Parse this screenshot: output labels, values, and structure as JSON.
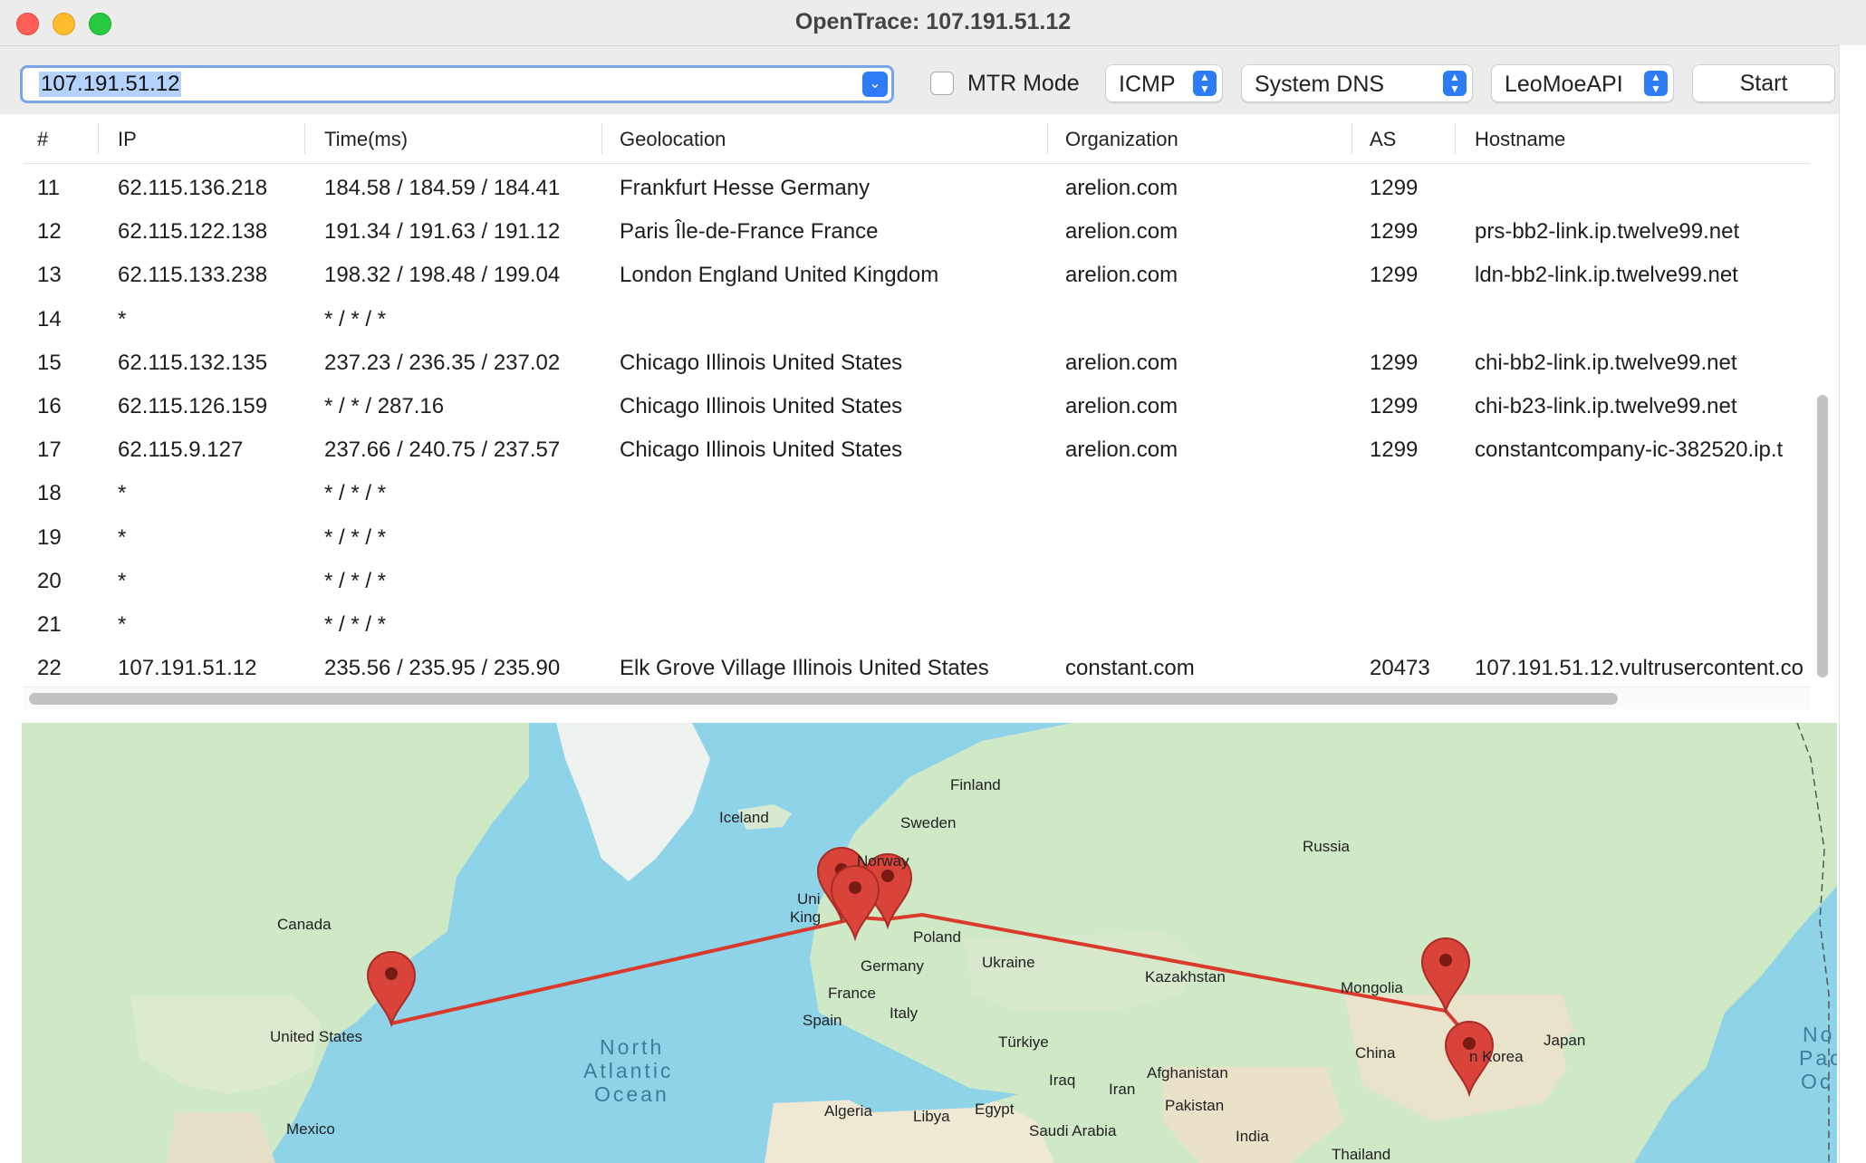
{
  "window": {
    "title": "OpenTrace: 107.191.51.12"
  },
  "toolbar": {
    "target_value": "107.191.51.12",
    "mtr_label": "MTR Mode",
    "protocol": "ICMP",
    "dns": "System DNS",
    "geo_api": "LeoMoeAPI",
    "start_label": "Start"
  },
  "table": {
    "columns": [
      "#",
      "IP",
      "Time(ms)",
      "Geolocation",
      "Organization",
      "AS",
      "Hostname"
    ],
    "rows": [
      {
        "hop": "11",
        "ip": "62.115.136.218",
        "time": "184.58 / 184.59 / 184.41",
        "geo": "Frankfurt Hesse Germany",
        "org": "arelion.com",
        "as": "1299",
        "host": ""
      },
      {
        "hop": "12",
        "ip": "62.115.122.138",
        "time": "191.34 / 191.63 / 191.12",
        "geo": "Paris Île-de-France France",
        "org": "arelion.com",
        "as": "1299",
        "host": "prs-bb2-link.ip.twelve99.net"
      },
      {
        "hop": "13",
        "ip": "62.115.133.238",
        "time": "198.32 / 198.48 / 199.04",
        "geo": "London England United Kingdom",
        "org": "arelion.com",
        "as": "1299",
        "host": "ldn-bb2-link.ip.twelve99.net"
      },
      {
        "hop": "14",
        "ip": "*",
        "time": "* / * / *",
        "geo": "",
        "org": "",
        "as": "",
        "host": ""
      },
      {
        "hop": "15",
        "ip": "62.115.132.135",
        "time": "237.23 / 236.35 / 237.02",
        "geo": "Chicago Illinois United States",
        "org": "arelion.com",
        "as": "1299",
        "host": "chi-bb2-link.ip.twelve99.net"
      },
      {
        "hop": "16",
        "ip": "62.115.126.159",
        "time": "* / * / 287.16",
        "geo": "Chicago Illinois United States",
        "org": "arelion.com",
        "as": "1299",
        "host": "chi-b23-link.ip.twelve99.net"
      },
      {
        "hop": "17",
        "ip": "62.115.9.127",
        "time": "237.66 / 240.75 / 237.57",
        "geo": "Chicago Illinois United States",
        "org": "arelion.com",
        "as": "1299",
        "host": "constantcompany-ic-382520.ip.t"
      },
      {
        "hop": "18",
        "ip": "*",
        "time": "* / * / *",
        "geo": "",
        "org": "",
        "as": "",
        "host": ""
      },
      {
        "hop": "19",
        "ip": "*",
        "time": "* / * / *",
        "geo": "",
        "org": "",
        "as": "",
        "host": ""
      },
      {
        "hop": "20",
        "ip": "*",
        "time": "* / * / *",
        "geo": "",
        "org": "",
        "as": "",
        "host": ""
      },
      {
        "hop": "21",
        "ip": "*",
        "time": "* / * / *",
        "geo": "",
        "org": "",
        "as": "",
        "host": ""
      },
      {
        "hop": "22",
        "ip": "107.191.51.12",
        "time": "235.56 / 235.95 / 235.90",
        "geo": "Elk Grove Village Illinois United States",
        "org": "constant.com",
        "as": "20473",
        "host": "107.191.51.12.vultrusercontent.co"
      }
    ]
  },
  "map": {
    "labels": {
      "finland": "Finland",
      "iceland": "Iceland",
      "sweden": "Sweden",
      "norway": "Norway",
      "russia": "Russia",
      "uk_1": "Uni",
      "uk_2": "King",
      "poland": "Poland",
      "canada": "Canada",
      "germany": "Germany",
      "ukraine": "Ukraine",
      "kazakhstan": "Kazakhstan",
      "mongolia": "Mongolia",
      "france": "France",
      "italy": "Italy",
      "spain": "Spain",
      "united_states": "United States",
      "turkiye": "Türkiye",
      "china": "China",
      "japan": "Japan",
      "korea": "n Korea",
      "north_atlantic_1": "North",
      "north_atlantic_2": "Atlantic",
      "north_atlantic_3": "Ocean",
      "iraq": "Iraq",
      "iran": "Iran",
      "afghanistan": "Afghanistan",
      "pakistan": "Pakistan",
      "algeria": "Algeria",
      "libya": "Libya",
      "egypt": "Egypt",
      "saudi_arabia": "Saudi Arabia",
      "india": "India",
      "mexico": "Mexico",
      "thailand": "Thailand",
      "north_pacific_1": "No",
      "north_pacific_2": "Pac",
      "north_pacific_3": "Oc"
    },
    "route_color": "#d93a2b",
    "marker_color": "#d9433a",
    "water_color": "#8fd3e8",
    "land_color": "#cfe8c6"
  },
  "colors": {
    "accent": "#2d7cf6",
    "selection": "#b3d3fd",
    "focus_ring": "#7aa5e8",
    "close": "#ff5f57",
    "minimize": "#febc2e",
    "maximize": "#28c840"
  }
}
